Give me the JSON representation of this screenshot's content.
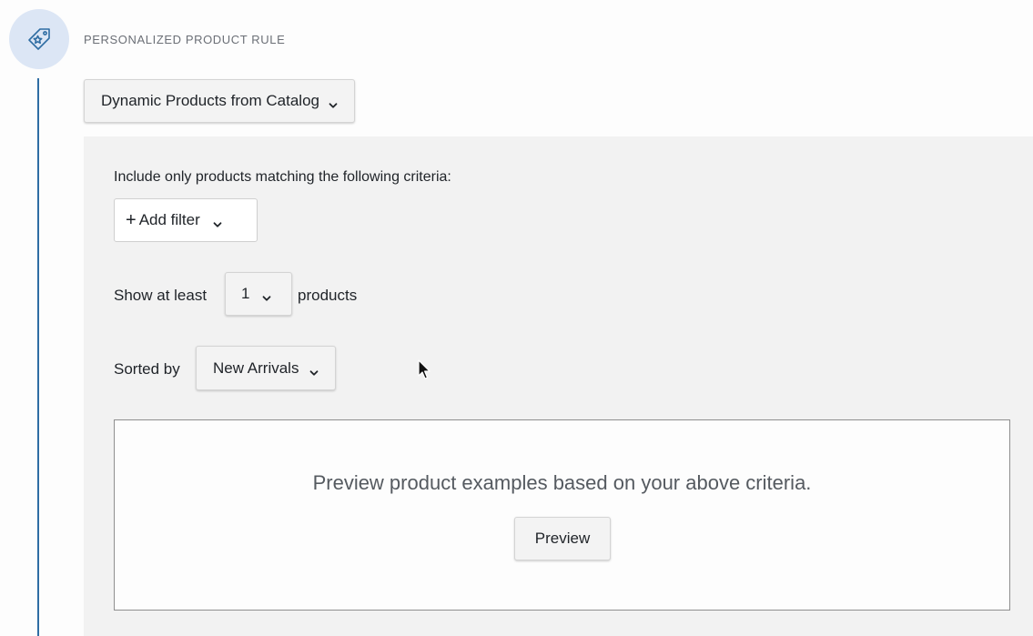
{
  "rule": {
    "title": "PERSONALIZED PRODUCT RULE",
    "icon": "tag-star-icon",
    "accent_color": "#2f6da3",
    "icon_bg_color": "#dce6f5"
  },
  "source_dropdown": {
    "selected": "Dynamic Products from Catalog",
    "icon": "chevron-down-icon"
  },
  "criteria": {
    "label": "Include only products matching the following criteria:",
    "add_filter_label": "Add filter",
    "add_filter_icon": "plus-icon"
  },
  "show_at_least": {
    "prefix": "Show at least",
    "value": "1",
    "suffix": "products"
  },
  "sorted_by": {
    "label": "Sorted by",
    "value": "New Arrivals"
  },
  "preview": {
    "message": "Preview product examples based on your above criteria.",
    "button_label": "Preview"
  }
}
